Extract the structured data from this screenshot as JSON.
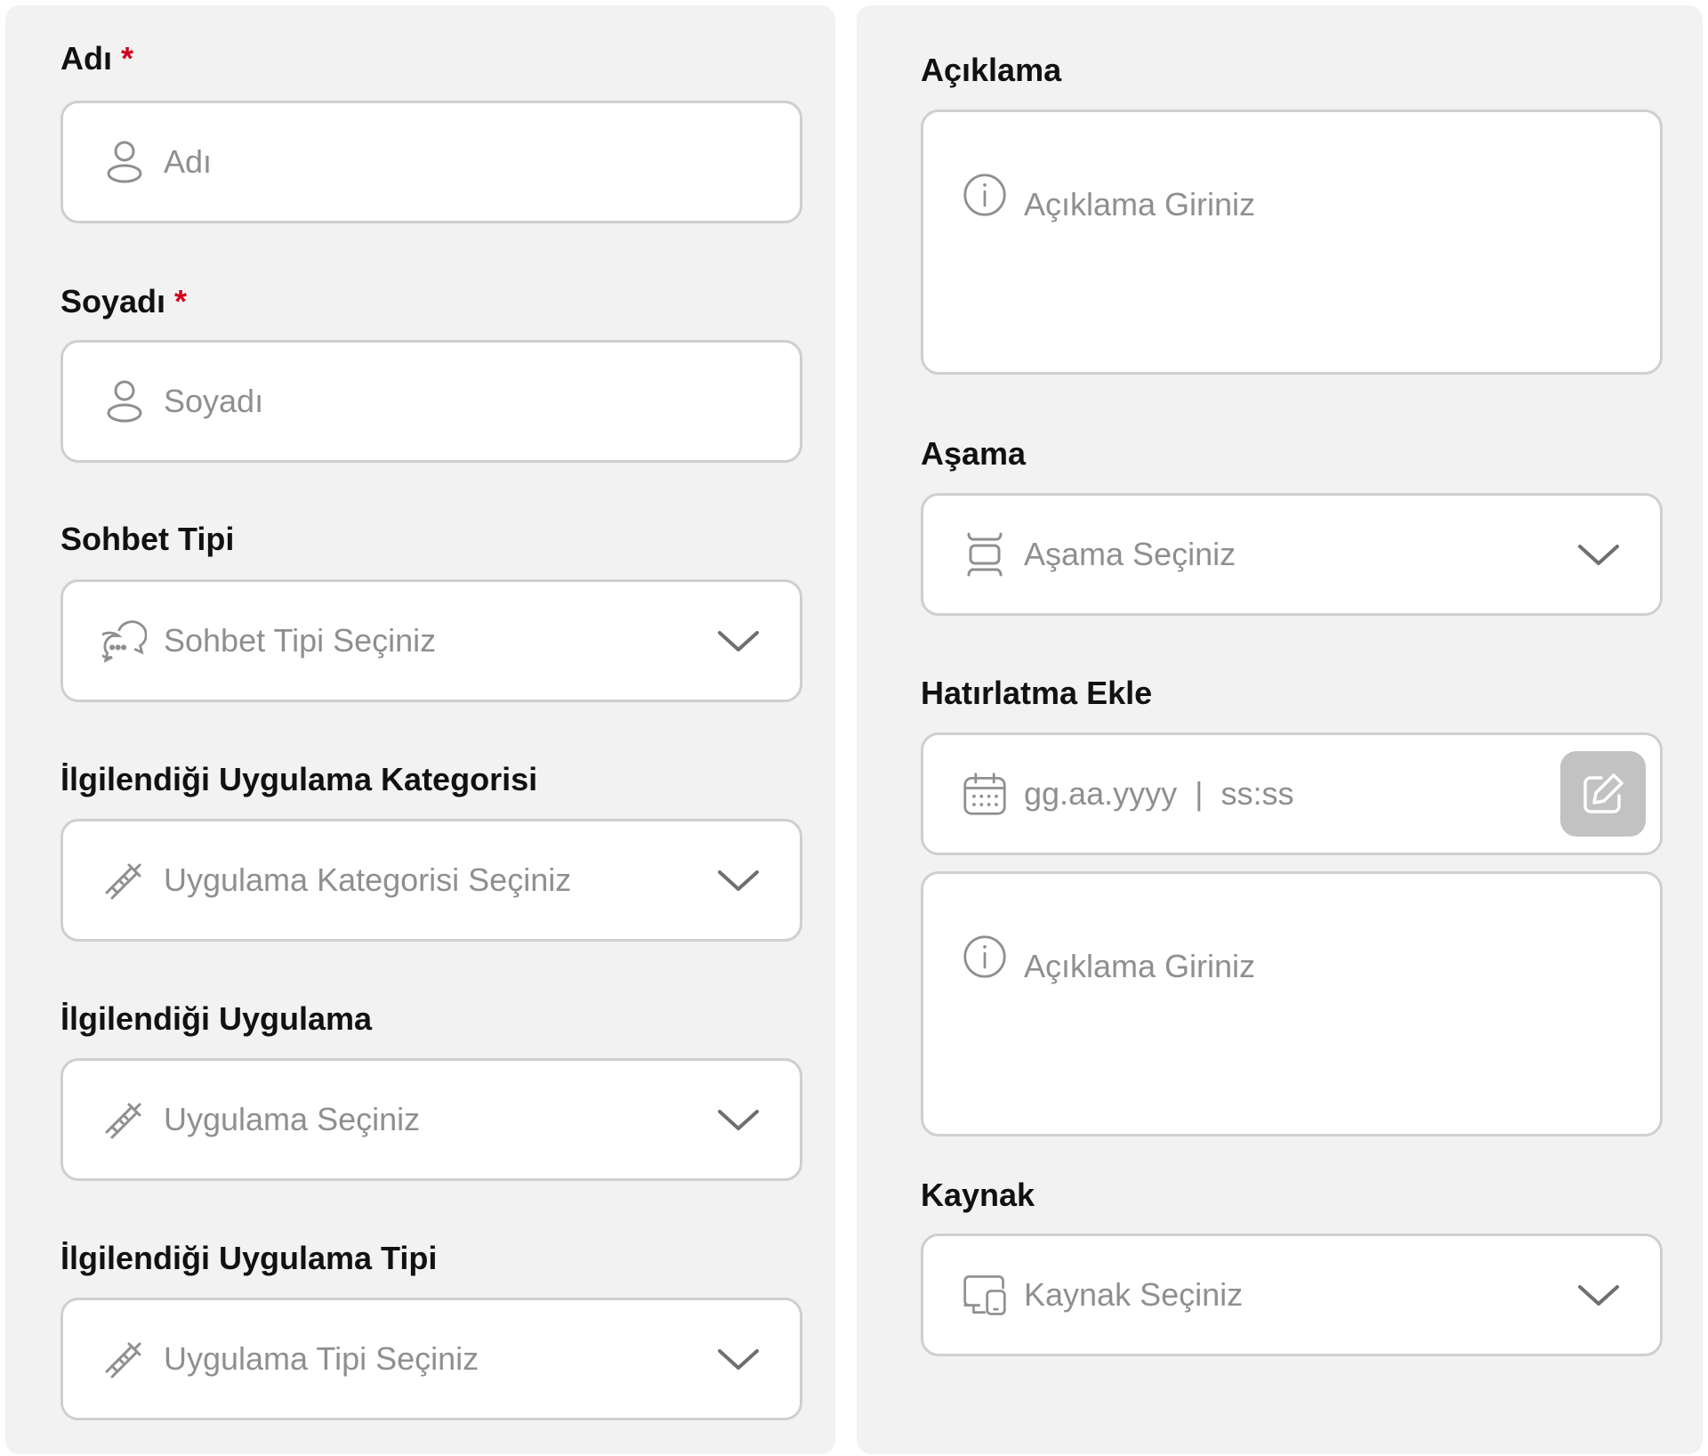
{
  "left": {
    "first_name": {
      "label": "Adı",
      "required_mark": "*",
      "placeholder": "Adı",
      "icon": "user-icon"
    },
    "last_name": {
      "label": "Soyadı",
      "required_mark": "*",
      "placeholder": "Soyadı",
      "icon": "user-icon"
    },
    "chat_type": {
      "label": "Sohbet Tipi",
      "placeholder": "Sohbet Tipi Seçiniz",
      "icon": "chat-bubbles-icon"
    },
    "app_category": {
      "label": "İlgilendiği Uygulama Kategorisi",
      "placeholder": "Uygulama Kategorisi Seçiniz",
      "icon": "syringe-icon"
    },
    "app": {
      "label": "İlgilendiği Uygulama",
      "placeholder": "Uygulama Seçiniz",
      "icon": "syringe-icon"
    },
    "app_type": {
      "label": "İlgilendiği Uygulama Tipi",
      "placeholder": "Uygulama Tipi Seçiniz",
      "icon": "syringe-icon"
    }
  },
  "right": {
    "description": {
      "label": "Açıklama",
      "placeholder": "Açıklama Giriniz",
      "icon": "info-icon"
    },
    "stage": {
      "label": "Aşama",
      "placeholder": "Aşama Seçiniz",
      "icon": "stage-icon"
    },
    "reminder": {
      "label": "Hatırlatma Ekle",
      "date_placeholder": "gg.aa.yyyy",
      "separator": "|",
      "time_placeholder": "ss:ss",
      "icon": "calendar-icon",
      "button_icon": "edit-icon",
      "note_placeholder": "Açıklama Giriniz"
    },
    "source": {
      "label": "Kaynak",
      "placeholder": "Kaynak Seçiniz",
      "icon": "devices-icon"
    }
  },
  "colors": {
    "panel_bg": "#f2f2f2",
    "field_border": "#cfcfcf",
    "placeholder": "#8f8f8f",
    "required": "#d0021b",
    "edit_button_bg": "#c2c2c2"
  }
}
